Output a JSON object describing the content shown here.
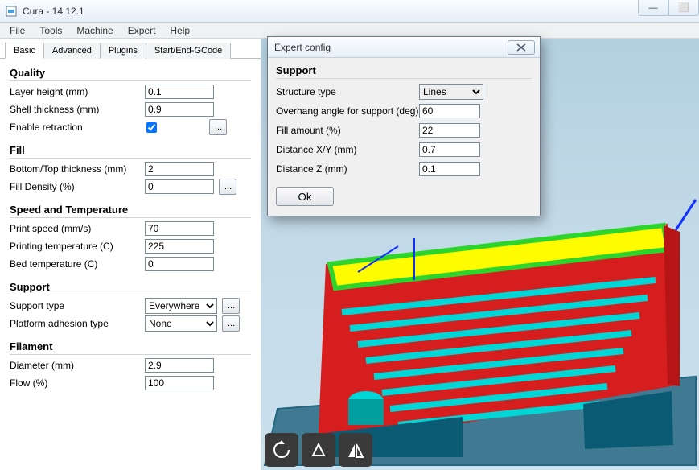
{
  "window": {
    "title": "Cura - 14.12.1"
  },
  "menu": {
    "items": [
      "File",
      "Tools",
      "Machine",
      "Expert",
      "Help"
    ]
  },
  "tabs": {
    "items": [
      "Basic",
      "Advanced",
      "Plugins",
      "Start/End-GCode"
    ],
    "active": 0
  },
  "settings": {
    "quality": {
      "heading": "Quality",
      "layer_height": {
        "label": "Layer height (mm)",
        "value": "0.1"
      },
      "shell_thickness": {
        "label": "Shell thickness (mm)",
        "value": "0.9"
      },
      "enable_retraction": {
        "label": "Enable retraction",
        "checked": true,
        "ellipsis": "..."
      }
    },
    "fill": {
      "heading": "Fill",
      "bottom_top": {
        "label": "Bottom/Top thickness (mm)",
        "value": "2"
      },
      "density": {
        "label": "Fill Density (%)",
        "value": "0",
        "ellipsis": "..."
      }
    },
    "speedtemp": {
      "heading": "Speed and Temperature",
      "print_speed": {
        "label": "Print speed (mm/s)",
        "value": "70"
      },
      "print_temp": {
        "label": "Printing temperature (C)",
        "value": "225"
      },
      "bed_temp": {
        "label": "Bed temperature (C)",
        "value": "0"
      }
    },
    "support": {
      "heading": "Support",
      "type": {
        "label": "Support type",
        "value": "Everywhere",
        "ellipsis": "..."
      },
      "adhesion": {
        "label": "Platform adhesion type",
        "value": "None",
        "ellipsis": "..."
      }
    },
    "filament": {
      "heading": "Filament",
      "diameter": {
        "label": "Diameter (mm)",
        "value": "2.9"
      },
      "flow": {
        "label": "Flow (%)",
        "value": "100"
      }
    }
  },
  "dialog": {
    "title": "Expert config",
    "section": "Support",
    "structure": {
      "label": "Structure type",
      "value": "Lines"
    },
    "overhang": {
      "label": "Overhang angle for support (deg)",
      "value": "60"
    },
    "fill": {
      "label": "Fill amount (%)",
      "value": "22"
    },
    "dist_xy": {
      "label": "Distance X/Y (mm)",
      "value": "0.7"
    },
    "dist_z": {
      "label": "Distance Z (mm)",
      "value": "0.1"
    },
    "ok": "Ok"
  },
  "winbtns": {
    "min": "—",
    "max": "⬜"
  }
}
